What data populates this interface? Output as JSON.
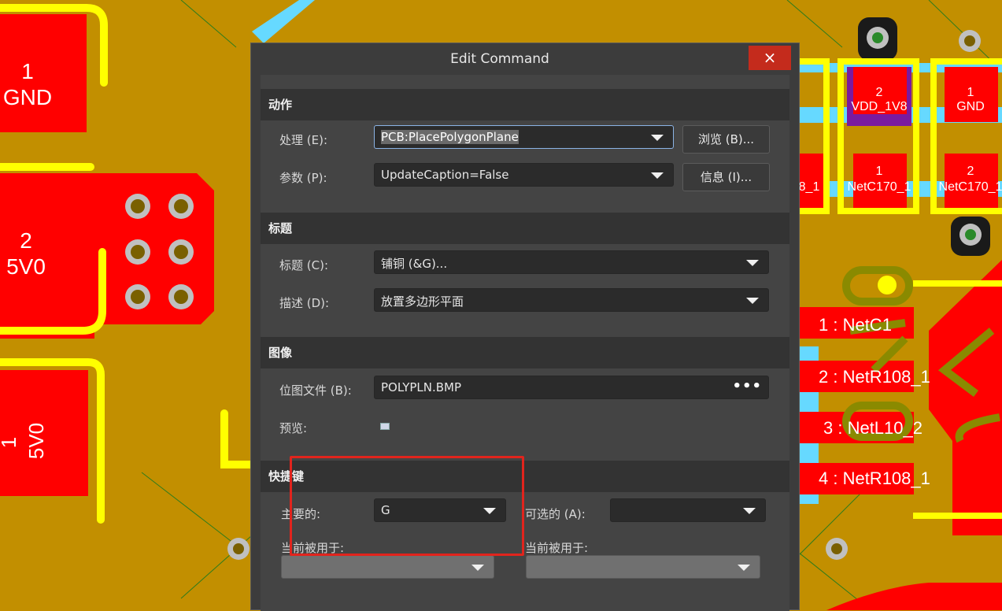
{
  "dialog": {
    "title": "Edit Command",
    "close_icon": "×"
  },
  "sections": {
    "action": {
      "header": "动作",
      "process_label": "处理 (E):",
      "process_value": "PCB:PlacePolygonPlane",
      "params_label": "参数 (P):",
      "params_value": "UpdateCaption=False",
      "browse_button": "浏览 (B)...",
      "info_button": "信息 (I)..."
    },
    "caption": {
      "header": "标题",
      "caption_label": "标题 (C):",
      "caption_value": "铺铜 (&G)...",
      "description_label": "描述 (D):",
      "description_value": "放置多边形平面"
    },
    "image": {
      "header": "图像",
      "bitmap_label": "位图文件 (B):",
      "bitmap_value": "POLYPLN.BMP",
      "browse_dots": "•••",
      "preview_label": "预览:"
    },
    "shortcut": {
      "header": "快捷键",
      "primary_label": "主要的:",
      "primary_value": "G",
      "alternate_label": "可选的 (A):",
      "alternate_value": "",
      "primary_used_label": "当前被用于:",
      "primary_used_value": "",
      "alternate_used_label": "当前被用于:",
      "alternate_used_value": ""
    }
  },
  "pcb": {
    "pads": [
      {
        "num": "1",
        "net": "GND"
      },
      {
        "num": "2",
        "net": "5V0"
      },
      {
        "num": "1",
        "net": "5V0"
      },
      {
        "num": "2",
        "net": "VDD_1V8"
      },
      {
        "num": "1",
        "net": "GND"
      },
      {
        "num": "1",
        "net": "NetC170_1"
      },
      {
        "num": "2",
        "net": "NetC170_1"
      }
    ],
    "partial_label": "8_1",
    "component_pins": [
      "1 : NetC1",
      "2 : NetR108_1",
      "3 : NetL10_2",
      "4 : NetR108_1"
    ],
    "colors": {
      "board": "#c28f00",
      "copper": "#ff0000",
      "silkscreen": "#ffff00",
      "keepout": "#66d9ff"
    }
  }
}
